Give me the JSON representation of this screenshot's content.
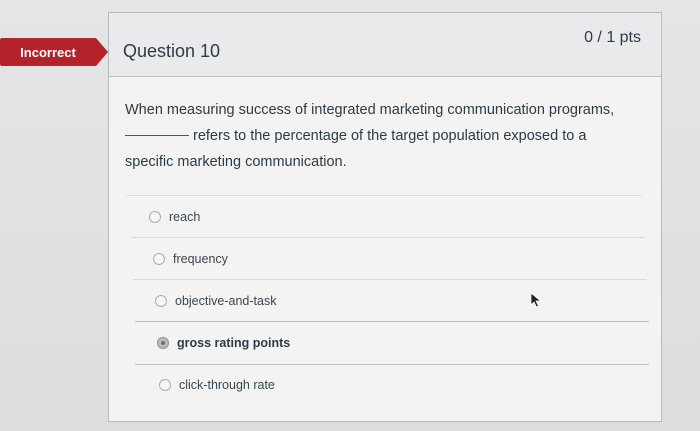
{
  "status_badge": {
    "label": "Incorrect",
    "color": "#b4222a"
  },
  "question": {
    "title": "Question 10",
    "points": "0 / 1 pts",
    "text_before_blank": "When measuring success of integrated marketing communication programs,",
    "text_after_blank": "refers to the percentage of the target population exposed to a specific marketing communication."
  },
  "answers": [
    {
      "label": "reach",
      "selected": false
    },
    {
      "label": "frequency",
      "selected": false
    },
    {
      "label": "objective-and-task",
      "selected": false
    },
    {
      "label": "gross rating points",
      "selected": true
    },
    {
      "label": "click-through rate",
      "selected": false
    }
  ],
  "icons": {
    "cursor": "mouse-pointer-icon"
  }
}
